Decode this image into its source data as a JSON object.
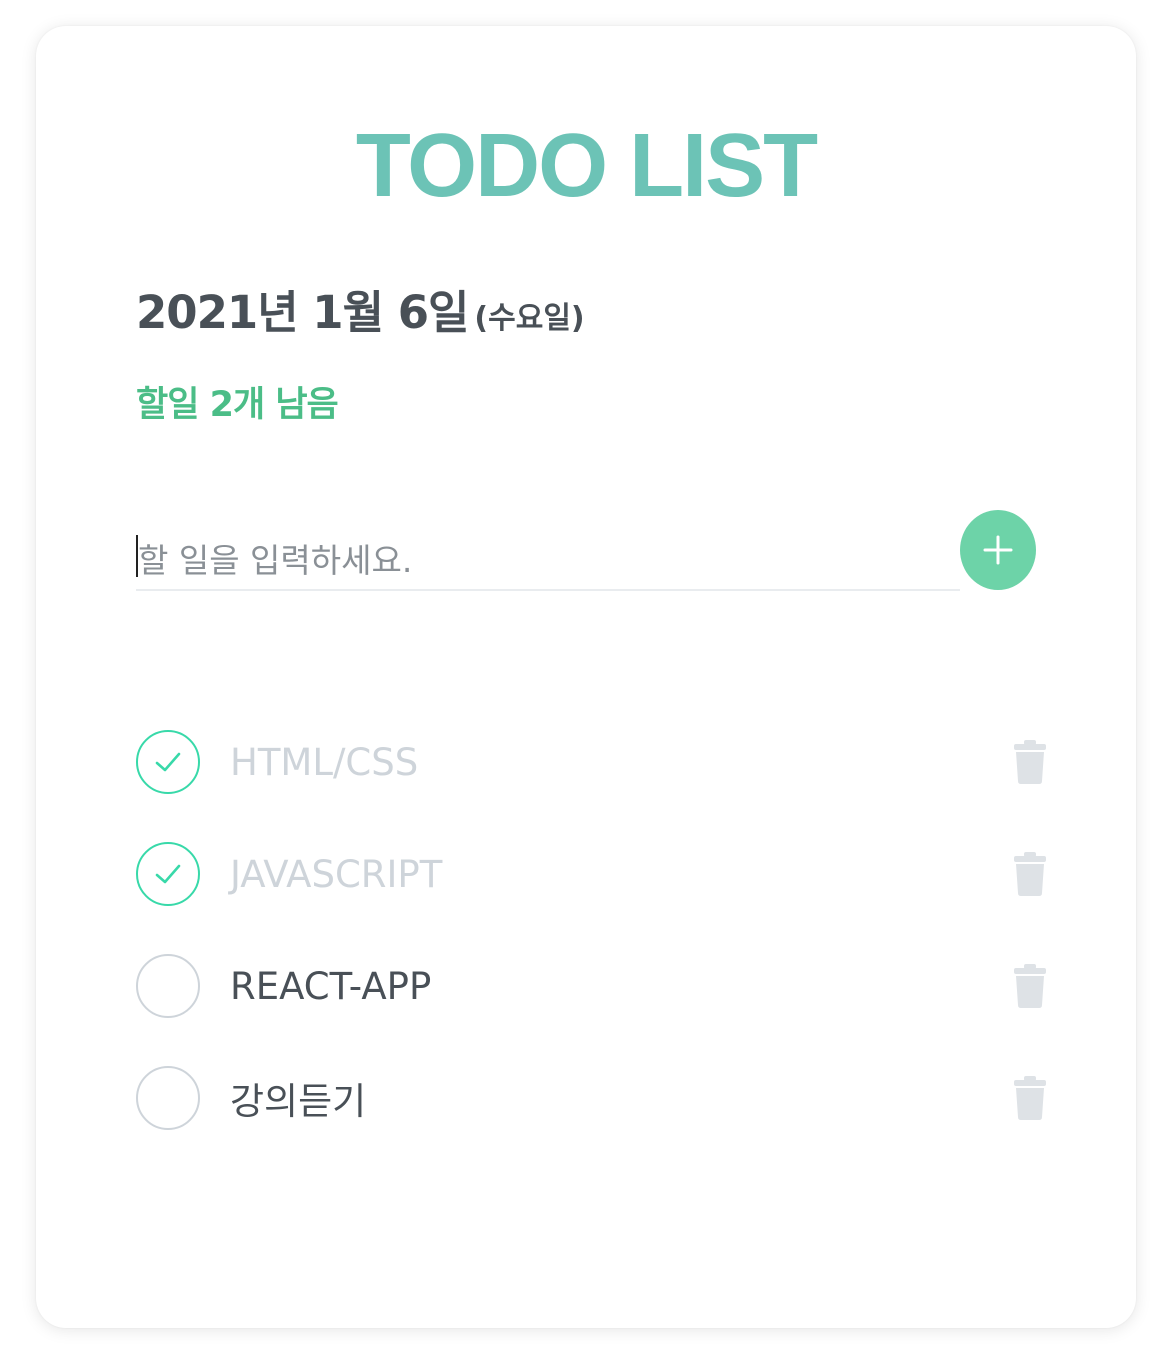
{
  "app": {
    "title": "TODO LIST",
    "date": "2021년 1월 6일",
    "day_of_week": "(수요일)",
    "remaining": "할일 2개 남음"
  },
  "input": {
    "placeholder": "할 일을 입력하세요.",
    "value": ""
  },
  "add_button": {
    "icon": "plus-icon"
  },
  "todos": [
    {
      "text": "HTML/CSS",
      "done": true
    },
    {
      "text": "JAVASCRIPT",
      "done": true
    },
    {
      "text": "REACT-APP",
      "done": false
    },
    {
      "text": "강의듣기",
      "done": false
    }
  ],
  "colors": {
    "title": "#6cc3b6",
    "remaining": "#4bbd87",
    "accent": "#6dd3a8",
    "check_border_done": "#38d9a9",
    "check_border": "#ced4da",
    "text": "#495057",
    "text_done": "#ced4da",
    "trash": "#dee2e6"
  }
}
